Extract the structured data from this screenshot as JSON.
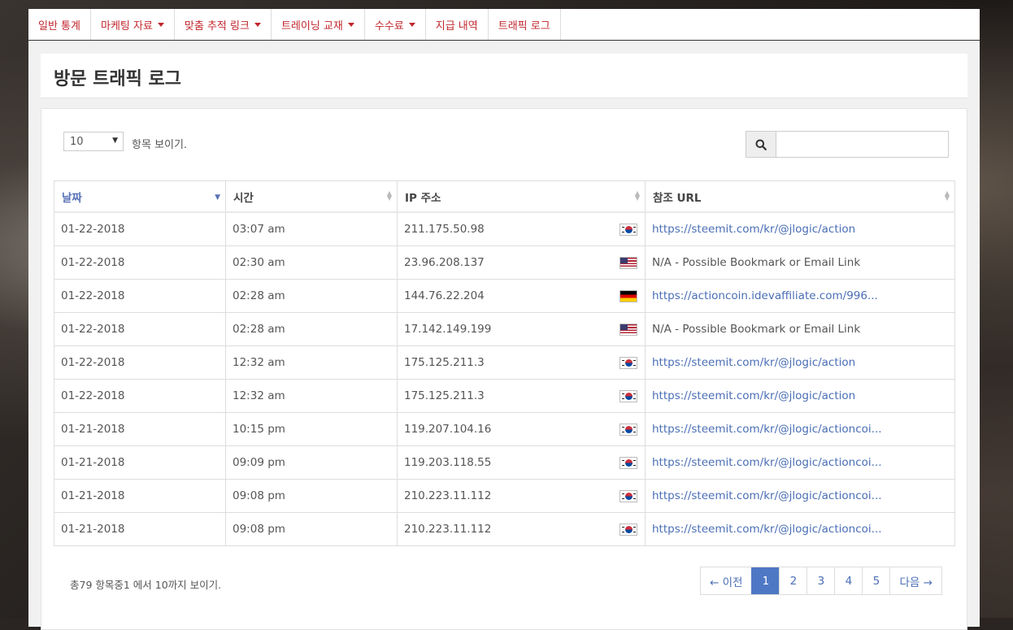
{
  "nav": [
    {
      "label": "일반 통계",
      "dropdown": false
    },
    {
      "label": "마케팅 자료",
      "dropdown": true
    },
    {
      "label": "맞춤 추적 링크",
      "dropdown": true
    },
    {
      "label": "트레이닝 교재",
      "dropdown": true
    },
    {
      "label": "수수료",
      "dropdown": true
    },
    {
      "label": "지급 내역",
      "dropdown": false
    },
    {
      "label": "트래픽 로그",
      "dropdown": false
    }
  ],
  "page": {
    "title": "방문 트래픽 로그"
  },
  "controls": {
    "length_value": "10",
    "length_label": "항목 보이기.",
    "search_placeholder": ""
  },
  "table": {
    "columns": [
      "날짜",
      "시간",
      "IP 주소",
      "참조 URL"
    ],
    "rows": [
      {
        "date": "01-22-2018",
        "time": "03:07 am",
        "ip": "211.175.50.98",
        "flag": "kr",
        "url": "https://steemit.com/kr/@jlogic/action",
        "link": true
      },
      {
        "date": "01-22-2018",
        "time": "02:30 am",
        "ip": "23.96.208.137",
        "flag": "us",
        "url": "N/A - Possible Bookmark or Email Link",
        "link": false
      },
      {
        "date": "01-22-2018",
        "time": "02:28 am",
        "ip": "144.76.22.204",
        "flag": "de",
        "url": "https://actioncoin.idevaffiliate.com/996...",
        "link": true
      },
      {
        "date": "01-22-2018",
        "time": "02:28 am",
        "ip": "17.142.149.199",
        "flag": "us",
        "url": "N/A - Possible Bookmark or Email Link",
        "link": false
      },
      {
        "date": "01-22-2018",
        "time": "12:32 am",
        "ip": "175.125.211.3",
        "flag": "kr",
        "url": "https://steemit.com/kr/@jlogic/action",
        "link": true
      },
      {
        "date": "01-22-2018",
        "time": "12:32 am",
        "ip": "175.125.211.3",
        "flag": "kr",
        "url": "https://steemit.com/kr/@jlogic/action",
        "link": true
      },
      {
        "date": "01-21-2018",
        "time": "10:15 pm",
        "ip": "119.207.104.16",
        "flag": "kr",
        "url": "https://steemit.com/kr/@jlogic/actioncoi...",
        "link": true
      },
      {
        "date": "01-21-2018",
        "time": "09:09 pm",
        "ip": "119.203.118.55",
        "flag": "kr",
        "url": "https://steemit.com/kr/@jlogic/actioncoi...",
        "link": true
      },
      {
        "date": "01-21-2018",
        "time": "09:08 pm",
        "ip": "210.223.11.112",
        "flag": "kr",
        "url": "https://steemit.com/kr/@jlogic/actioncoi...",
        "link": true
      },
      {
        "date": "01-21-2018",
        "time": "09:08 pm",
        "ip": "210.223.11.112",
        "flag": "kr",
        "url": "https://steemit.com/kr/@jlogic/actioncoi...",
        "link": true
      }
    ]
  },
  "footer": {
    "info": "총79 항목중1 에서 10까지 보이기."
  },
  "pagination": {
    "prev": "← 이전",
    "pages": [
      "1",
      "2",
      "3",
      "4",
      "5"
    ],
    "active": "1",
    "next": "다음 →"
  },
  "icons": {
    "search": "search-icon",
    "flags": {
      "kr": "south-korea-flag-icon",
      "us": "usa-flag-icon",
      "de": "germany-flag-icon"
    }
  },
  "colors": {
    "nav_text": "#c0262d",
    "link": "#4a6eb5",
    "pager_active": "#4f78c4"
  }
}
